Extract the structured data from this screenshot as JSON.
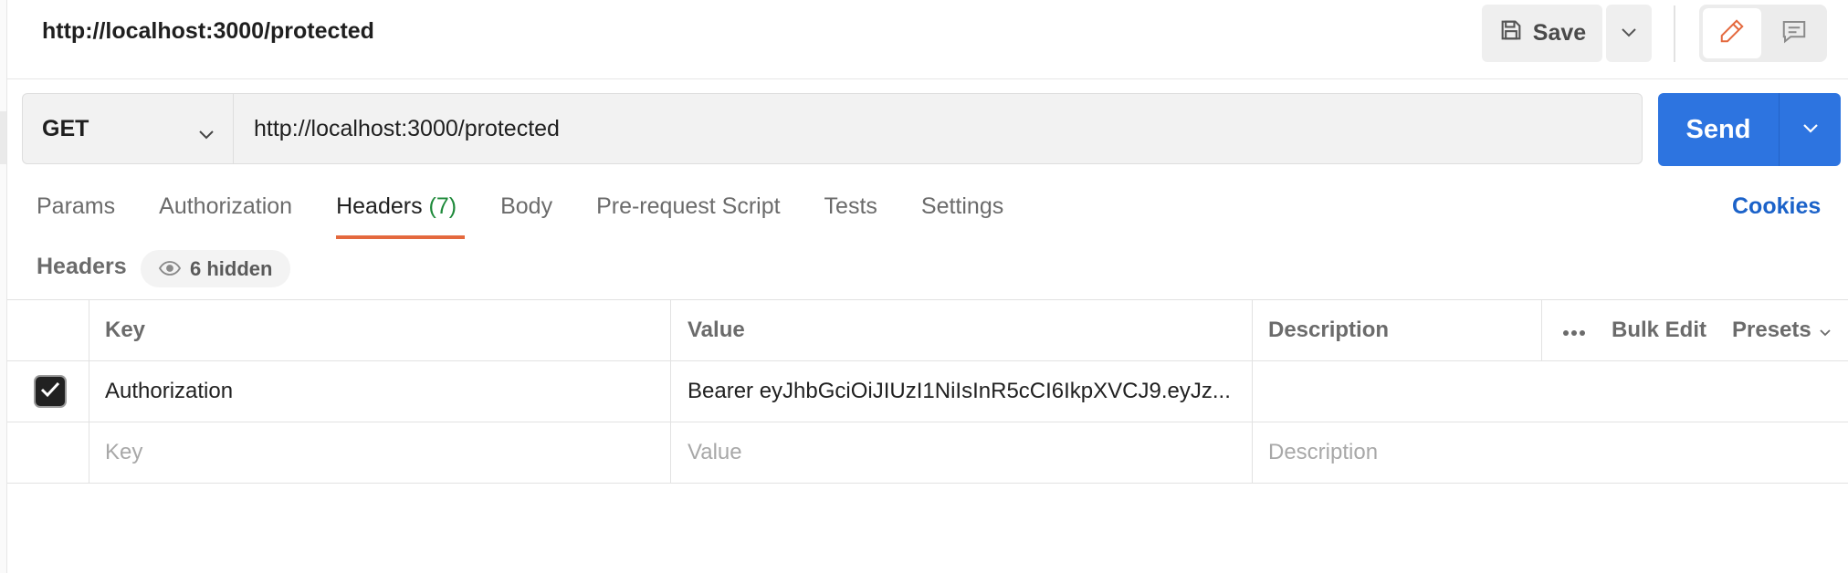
{
  "header": {
    "request_title": "http://localhost:3000/protected",
    "save_label": "Save"
  },
  "request": {
    "method": "GET",
    "url": "http://localhost:3000/protected",
    "send_label": "Send"
  },
  "tabs": [
    {
      "label": "Params",
      "count": ""
    },
    {
      "label": "Authorization",
      "count": ""
    },
    {
      "label": "Headers",
      "count": "(7)",
      "active": true
    },
    {
      "label": "Body",
      "count": ""
    },
    {
      "label": "Pre-request Script",
      "count": ""
    },
    {
      "label": "Tests",
      "count": ""
    },
    {
      "label": "Settings",
      "count": ""
    }
  ],
  "cookies_label": "Cookies",
  "headers_section": {
    "title": "Headers",
    "hidden_label": "6 hidden"
  },
  "table": {
    "columns": {
      "key": "Key",
      "value": "Value",
      "description": "Description"
    },
    "tools": {
      "bulk_edit": "Bulk Edit",
      "presets": "Presets"
    },
    "rows": [
      {
        "checked": true,
        "key": "Authorization",
        "value": "Bearer eyJhbGciOiJIUzI1NiIsInR5cCI6IkpXVCJ9.eyJz...",
        "description": ""
      }
    ],
    "placeholders": {
      "key": "Key",
      "value": "Value",
      "description": "Description"
    }
  },
  "colors": {
    "accent_send": "#2d74e0",
    "tab_underline": "#e4693e",
    "count_green": "#1f8a3b",
    "cookies_link": "#1b62c9"
  },
  "icons": [
    "save-icon",
    "chevron-down-icon",
    "pencil-icon",
    "comment-icon",
    "eye-icon",
    "checkmark-icon",
    "more-horizontal-icon"
  ]
}
